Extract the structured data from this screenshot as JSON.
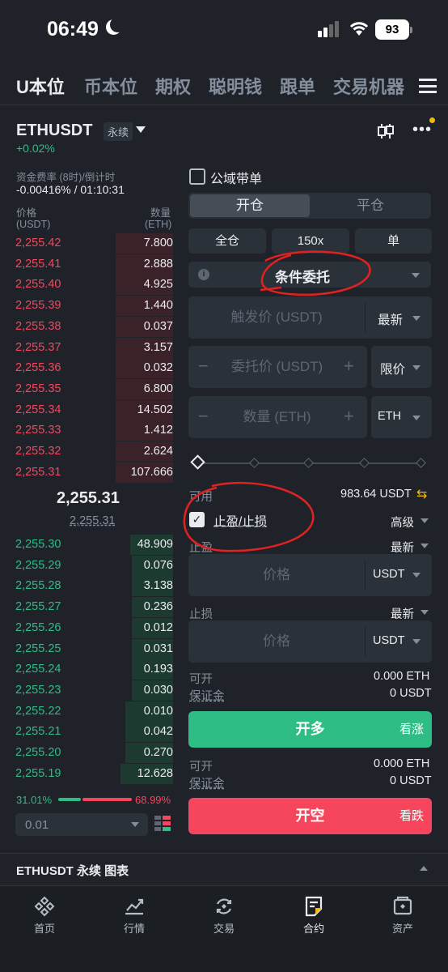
{
  "status_bar": {
    "time": "06:49",
    "battery": "93"
  },
  "nav_tabs": [
    "U本位",
    "币本位",
    "期权",
    "聪明钱",
    "跟单",
    "交易机器"
  ],
  "header": {
    "symbol": "ETHUSDT",
    "contract_type": "永续",
    "change": "+0.02%"
  },
  "funding": {
    "label": "资金费率 (8时)/倒计时",
    "value": "-0.00416% / 01:10:31"
  },
  "orderbook": {
    "price_header": "价格",
    "price_unit": "(USDT)",
    "qty_header": "数量",
    "qty_unit": "(ETH)",
    "asks": [
      {
        "price": "2,255.42",
        "qty": "7.800",
        "depth": 0.36
      },
      {
        "price": "2,255.41",
        "qty": "2.888",
        "depth": 0.36
      },
      {
        "price": "2,255.40",
        "qty": "4.925",
        "depth": 0.36
      },
      {
        "price": "2,255.39",
        "qty": "1.440",
        "depth": 0.36
      },
      {
        "price": "2,255.38",
        "qty": "0.037",
        "depth": 0.36
      },
      {
        "price": "2,255.37",
        "qty": "3.157",
        "depth": 0.36
      },
      {
        "price": "2,255.36",
        "qty": "0.032",
        "depth": 0.36
      },
      {
        "price": "2,255.35",
        "qty": "6.800",
        "depth": 0.36
      },
      {
        "price": "2,255.34",
        "qty": "14.502",
        "depth": 0.36
      },
      {
        "price": "2,255.33",
        "qty": "1.412",
        "depth": 0.36
      },
      {
        "price": "2,255.32",
        "qty": "2.624",
        "depth": 0.36
      },
      {
        "price": "2,255.31",
        "qty": "107.666",
        "depth": 0.36
      }
    ],
    "mid_price": "2,255.31",
    "mark_price": "2,255.31",
    "bids": [
      {
        "price": "2,255.30",
        "qty": "48.909",
        "depth": 0.27
      },
      {
        "price": "2,255.29",
        "qty": "0.076",
        "depth": 0.26
      },
      {
        "price": "2,255.28",
        "qty": "3.138",
        "depth": 0.26
      },
      {
        "price": "2,255.27",
        "qty": "0.236",
        "depth": 0.26
      },
      {
        "price": "2,255.26",
        "qty": "0.012",
        "depth": 0.26
      },
      {
        "price": "2,255.25",
        "qty": "0.031",
        "depth": 0.26
      },
      {
        "price": "2,255.24",
        "qty": "0.193",
        "depth": 0.26
      },
      {
        "price": "2,255.23",
        "qty": "0.030",
        "depth": 0.26
      },
      {
        "price": "2,255.22",
        "qty": "0.010",
        "depth": 0.3
      },
      {
        "price": "2,255.21",
        "qty": "0.042",
        "depth": 0.3
      },
      {
        "price": "2,255.20",
        "qty": "0.270",
        "depth": 0.3
      },
      {
        "price": "2,255.19",
        "qty": "12.628",
        "depth": 0.33
      }
    ],
    "buy_ratio": "31.01%",
    "sell_ratio": "68.99%",
    "buy_fraction": 0.31,
    "precision": "0.01"
  },
  "order_form": {
    "public_copy": "公域带单",
    "tab_open": "开仓",
    "tab_close": "平仓",
    "margin_mode": "全仓",
    "leverage": "150x",
    "position_mode": "单",
    "order_type": "条件委托",
    "trigger_placeholder": "触发价 (USDT)",
    "trigger_type": "最新",
    "price_placeholder": "委托价 (USDT)",
    "price_type": "限价",
    "qty_placeholder": "数量 (ETH)",
    "qty_unit": "ETH",
    "available_label": "可用",
    "available_value": "983.64 USDT",
    "tpsl_label": "止盈/止损",
    "advanced": "高级",
    "tp_label": "止盈",
    "tp_type": "最新",
    "tp_placeholder": "价格",
    "tp_unit": "USDT",
    "sl_label": "止损",
    "sl_type": "最新",
    "sl_placeholder": "价格",
    "sl_unit": "USDT",
    "long": {
      "can_open_label": "可开",
      "can_open_value": "0.000 ETH",
      "margin_label": "保证金",
      "margin_value": "0 USDT",
      "button": "开多",
      "sub": "看涨"
    },
    "short": {
      "can_open_label": "可开",
      "can_open_value": "0.000 ETH",
      "margin_label": "保证金",
      "margin_value": "0 USDT",
      "button": "开空",
      "sub": "看跌"
    }
  },
  "chart_link": "ETHUSDT 永续 图表",
  "tabbar": [
    "首页",
    "行情",
    "交易",
    "合约",
    "资产"
  ],
  "colors": {
    "buy": "#2ebd85",
    "sell": "#f6465d",
    "accent": "#f0b90b",
    "annotation": "#e22222"
  }
}
